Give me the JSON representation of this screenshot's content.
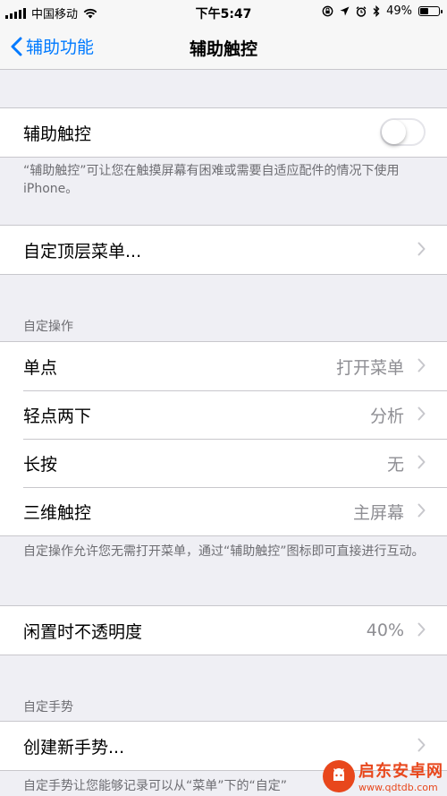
{
  "status_bar": {
    "carrier": "中国移动",
    "time": "下午5:47",
    "battery": "49%",
    "battery_level": 0.49
  },
  "nav": {
    "back_label": "辅助功能",
    "title": "辅助触控"
  },
  "assistive_touch": {
    "label": "辅助触控",
    "enabled": false,
    "description": "“辅助触控”可让您在触摸屏幕有困难或需要自适应配件的情况下使用 iPhone。"
  },
  "top_menu": {
    "label": "自定顶层菜单..."
  },
  "custom_actions": {
    "header": "自定操作",
    "rows": [
      {
        "label": "单点",
        "value": "打开菜单"
      },
      {
        "label": "轻点两下",
        "value": "分析"
      },
      {
        "label": "长按",
        "value": "无"
      },
      {
        "label": "三维触控",
        "value": "主屏幕"
      }
    ],
    "footer": "自定操作允许您无需打开菜单，通过“辅助触控”图标即可直接进行互动。"
  },
  "idle_opacity": {
    "label": "闲置时不透明度",
    "value": "40%"
  },
  "custom_gestures": {
    "header": "自定手势",
    "create_label": "创建新手势...",
    "footer": "自定手势让您能够记录可以从“菜单”下的“自定”"
  },
  "watermark": {
    "title": "启东安卓网",
    "url": "www.qdtdb.com"
  },
  "colors": {
    "ios_blue": "#007aff",
    "background": "#efeff4",
    "secondary_text": "#8e8e93",
    "watermark": "#e8471c"
  }
}
